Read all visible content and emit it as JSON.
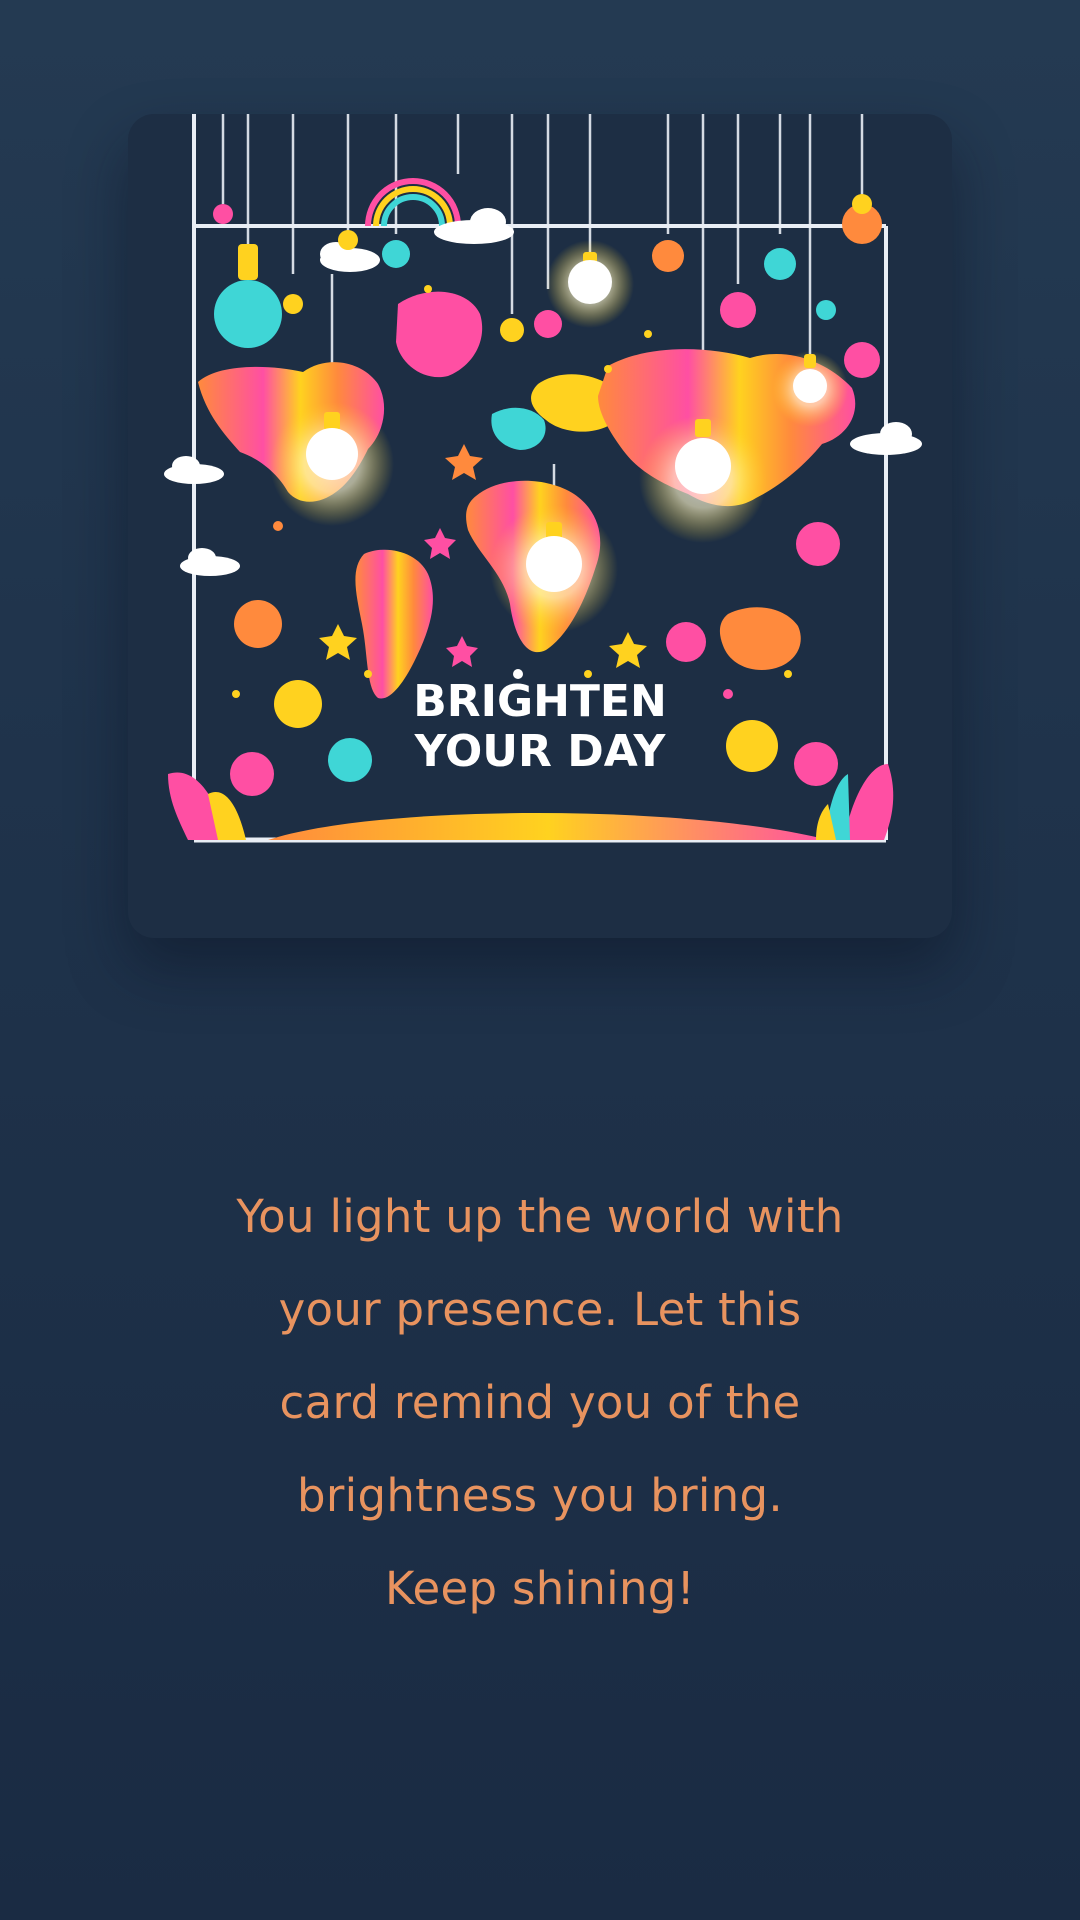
{
  "card": {
    "image_title_line1": "BRIGHTEN",
    "image_title_line2": "YOUR DAY",
    "image_subject": "world-map-with-hanging-light-bulbs-illustration"
  },
  "message": {
    "lines": [
      "You light up the world with",
      "your presence. Let this",
      "card remind you of the",
      "brightness you bring.",
      "Keep shining!"
    ]
  },
  "colors": {
    "background": "#1f334b",
    "message_text": "#e8935f",
    "illustration_pink": "#ff4fa3",
    "illustration_orange": "#ff8a3d",
    "illustration_yellow": "#ffd21f",
    "illustration_teal": "#3fd6d6"
  }
}
